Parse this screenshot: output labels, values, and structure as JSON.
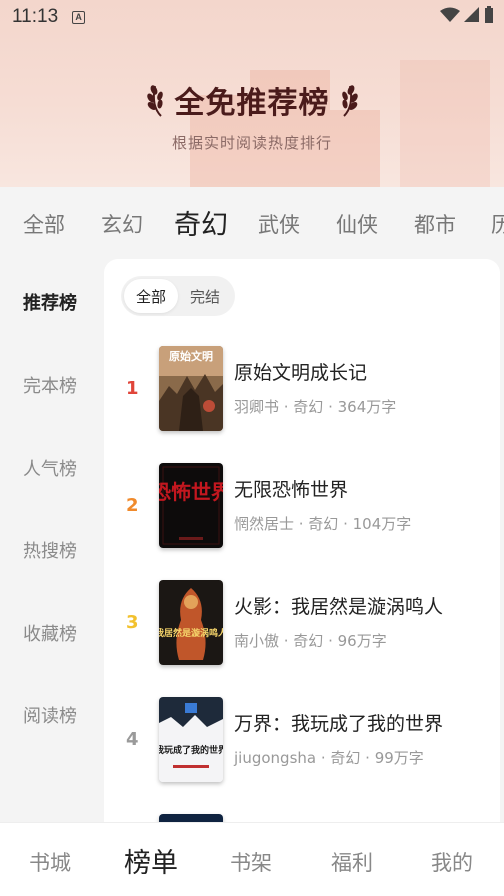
{
  "status_bar": {
    "time": "11:13",
    "notification_icon": "a-letter-icon",
    "icons": [
      "wifi-icon",
      "signal-icon",
      "battery-icon"
    ]
  },
  "header": {
    "title": "全免推荐榜",
    "subtitle": "根据实时阅读热度排行",
    "title_color": "#4a1b1b"
  },
  "category_tabs": [
    {
      "label": "全部",
      "active": false
    },
    {
      "label": "玄幻",
      "active": false
    },
    {
      "label": "奇幻",
      "active": true
    },
    {
      "label": "武侠",
      "active": false
    },
    {
      "label": "仙侠",
      "active": false
    },
    {
      "label": "都市",
      "active": false
    },
    {
      "label": "历",
      "active": false
    }
  ],
  "side_nav": [
    {
      "label": "推荐榜",
      "active": true
    },
    {
      "label": "完本榜",
      "active": false
    },
    {
      "label": "人气榜",
      "active": false
    },
    {
      "label": "热搜榜",
      "active": false
    },
    {
      "label": "收藏榜",
      "active": false
    },
    {
      "label": "阅读榜",
      "active": false
    }
  ],
  "filter": {
    "options": [
      "全部",
      "完结"
    ],
    "selected": "全部"
  },
  "books": [
    {
      "rank": "1",
      "rank_color": "#e0453a",
      "title": "原始文明成长记",
      "author": "羽卿书",
      "genre": "奇幻",
      "words": "364万字",
      "meta": "羽卿书 · 奇幻 · 364万字",
      "cover_text": "原始文明"
    },
    {
      "rank": "2",
      "rank_color": "#f08a2c",
      "title": "无限恐怖世界",
      "author": "惘然居士",
      "genre": "奇幻",
      "words": "104万字",
      "meta": "惘然居士 · 奇幻 · 104万字",
      "cover_text": "恐怖世界"
    },
    {
      "rank": "3",
      "rank_color": "#f2c12e",
      "title": "火影：我居然是漩涡鸣人",
      "author": "南小傲",
      "genre": "奇幻",
      "words": "96万字",
      "meta": "南小傲 · 奇幻 · 96万字",
      "cover_text": "我居然是漩涡鸣人"
    },
    {
      "rank": "4",
      "rank_color": "#9a9a9a",
      "title": "万界：我玩成了我的世界",
      "author": "jiugongsha",
      "genre": "奇幻",
      "words": "99万字",
      "meta": "jiugongsha · 奇幻 · 99万字",
      "cover_text": "我玩成了我的世界"
    }
  ],
  "bottom_nav": [
    {
      "label": "书城",
      "active": false
    },
    {
      "label": "榜单",
      "active": true
    },
    {
      "label": "书架",
      "active": false
    },
    {
      "label": "福利",
      "active": false
    },
    {
      "label": "我的",
      "active": false
    }
  ]
}
